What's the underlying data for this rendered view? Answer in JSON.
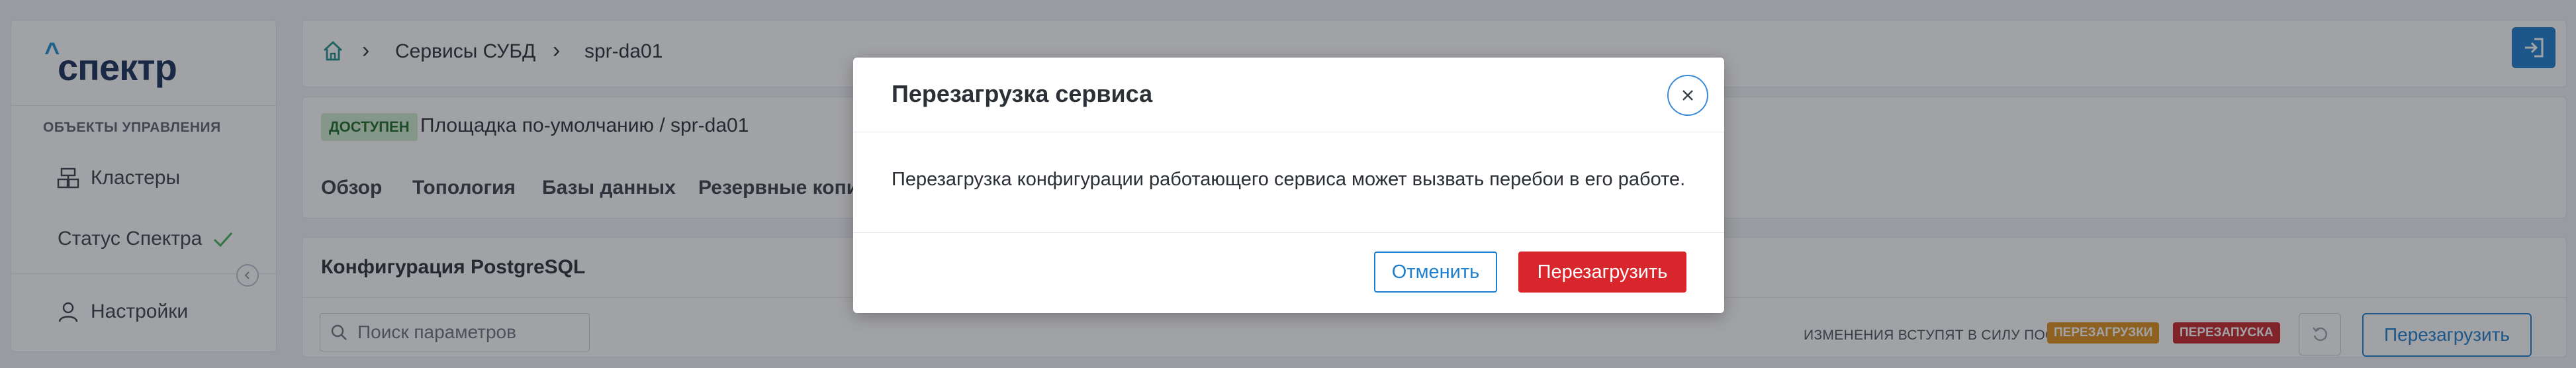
{
  "sidebar": {
    "logo": "спектр",
    "logo_caret": "^",
    "section_title": "ОБЪЕКТЫ УПРАВЛЕНИЯ",
    "items": [
      {
        "label": "Кластеры",
        "icon": "cluster-icon"
      },
      {
        "label": "Статус Спектра",
        "icon": "check-icon"
      },
      {
        "label": "Настройки",
        "icon": "user-icon"
      }
    ]
  },
  "breadcrumb": {
    "home_icon": "home-icon",
    "items": [
      "Сервисы СУБД",
      "spr-da01"
    ]
  },
  "service": {
    "status_badge": "ДОСТУПЕН",
    "title": "Площадка по-умолчанию / spr-da01",
    "tabs": [
      "Обзор",
      "Топология",
      "Базы данных",
      "Резервные копии"
    ]
  },
  "config": {
    "title": "Конфигурация PostgreSQL",
    "search_placeholder": "Поиск параметров",
    "note": "ИЗМЕНЕНИЯ ВСТУПЯТ В СИЛУ ПОСЛЕ",
    "tag_reload": "ПЕРЕЗАГРУЗКИ",
    "tag_restart": "ПЕРЕЗАПУСКА",
    "restart_button": "Перезагрузить"
  },
  "modal": {
    "title": "Перезагрузка сервиса",
    "body": "Перезагрузка конфигурации работающего сервиса может вызвать перебои в его работе.",
    "cancel": "Отменить",
    "confirm": "Перезагрузить"
  },
  "colors": {
    "accent": "#1d7fd0",
    "danger": "#d8262c",
    "tag_reload": "#e0901c",
    "tag_restart": "#c8262c",
    "status_ok_bg": "#cfeccf"
  }
}
